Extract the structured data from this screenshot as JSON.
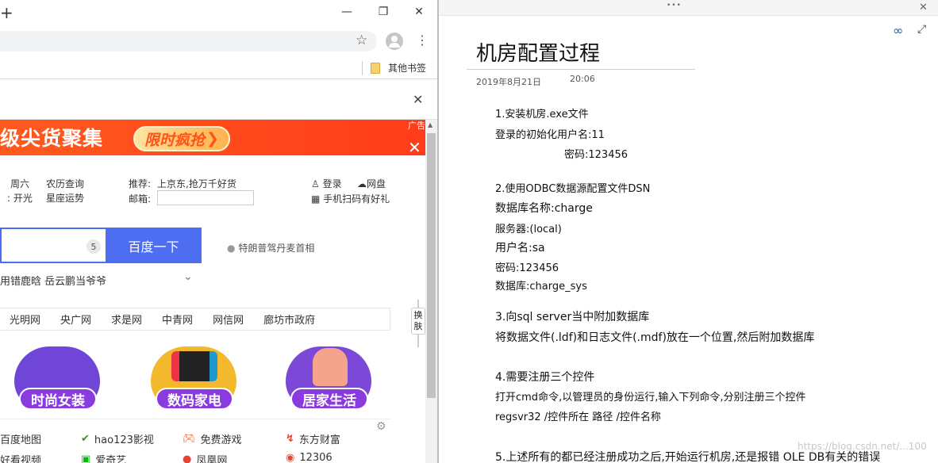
{
  "browser": {
    "window_controls": {
      "minimize": "—",
      "maximize": "❐",
      "close": "✕"
    },
    "new_tab_label": "+",
    "bookmarks_folder": "其他书签"
  },
  "page": {
    "ad": {
      "banner_text": "超级尖货聚集",
      "cta": "限时疯抢",
      "ad_label": "广告"
    },
    "info": {
      "weekday": "周六",
      "row2_a": "开光",
      "almanac": "农历查询",
      "horoscope": "星座运势",
      "recommend_label": "推荐:",
      "recommend_text": "上京东,抢万千好货",
      "mailbox_label": "邮箱:",
      "login": "登录",
      "netdisk": "网盘",
      "scan": "手机扫码有好礼"
    },
    "search": {
      "badge": "5",
      "button": "百度一下",
      "hot_topic": "特朗普驾丹麦首相",
      "hot_row": "用错鹿晗  岳云鹏当爷爷"
    },
    "nav_links": [
      "光明网",
      "央广网",
      "求是网",
      "中青网",
      "网信网",
      "廊坊市政府"
    ],
    "skin_button": "换肤",
    "promos": [
      "时尚女装",
      "数码家电",
      "居家生活"
    ],
    "sites_row1": [
      "百度地图",
      "hao123影视",
      "免费游戏",
      "东方财富"
    ],
    "sites_row2": [
      "好看视频",
      "爱奇艺",
      "凤凰网",
      "12306"
    ]
  },
  "note": {
    "title": "机房配置过程",
    "date": "2019年8月21日",
    "time": "20:06",
    "lines": [
      "1.安装机房.exe文件",
      "登录的初始化用户名:11",
      "密码:123456",
      "2.使用ODBC数据源配置文件DSN",
      "数据库名称:charge",
      "服务器:(local)",
      "用户名:sa",
      "密码:123456",
      "数据库:charge_sys",
      "3.向sql server当中附加数据库",
      "将数据文件(.ldf)和日志文件(.mdf)放在一个位置,然后附加数据库",
      "4.需要注册三个控件",
      "打开cmd命令,以管理员的身份运行,输入下列命令,分别注册三个控件",
      "regsvr32 /控件所在 路径 /控件名称",
      "5.上述所有的都已经注册成功之后,开始运行机房,还是报错 OLE DB有关的错误"
    ],
    "watermark": "https://blog.csdn.net/...100",
    "menu_dots": "•••",
    "close": "✕"
  },
  "colors": {
    "baidu_blue": "#4e6ef2",
    "ad_orange": "#ff4a1c",
    "promo_purple": "#8a3be0"
  }
}
